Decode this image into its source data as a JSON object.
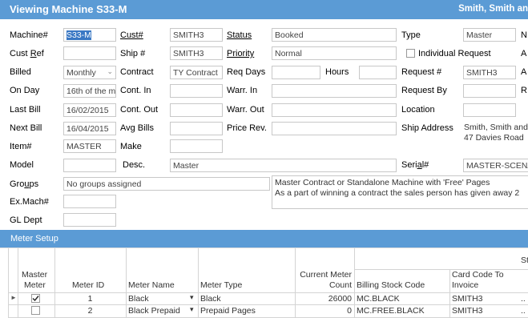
{
  "window": {
    "title": "Viewing Machine S33-M",
    "customer_header": "Smith, Smith an"
  },
  "form": {
    "machine_label": "Machine#",
    "machine_value": "S33-M",
    "cust_label": "Cust#",
    "cust_value": "SMITH3",
    "status_label": "Status",
    "status_value": "Booked",
    "type_label": "Type",
    "type_value": "Master",
    "type_right_cut": "N",
    "custref_label": "Cust Ref",
    "custref_value": "",
    "ship_label": "Ship #",
    "ship_value": "SMITH3",
    "priority_label": "Priority",
    "priority_value": "Normal",
    "individual_request_label": "Individual Request",
    "row2_right_cut": "A",
    "billed_label": "Billed",
    "billed_value": "Monthly",
    "contract_label": "Contract",
    "contract_value": "TY Contract",
    "reqdays_label": "Req Days",
    "reqdays_value": "",
    "hours_label": "Hours",
    "hours_value": "",
    "request_label": "Request #",
    "request_value": "SMITH3",
    "row3_right_cut": "A",
    "onday_label": "On Day",
    "onday_value": "16th of the m",
    "contin_label": "Cont. In",
    "contin_value": "",
    "warrin_label": "Warr. In",
    "warrin_value": "",
    "requestby_label": "Request By",
    "requestby_value": "",
    "row4_right_cut": "R",
    "lastbill_label": "Last Bill",
    "lastbill_value": "16/02/2015",
    "contout_label": "Cont. Out",
    "contout_value": "",
    "warrout_label": "Warr. Out",
    "warrout_value": "",
    "location_label": "Location",
    "location_value": "",
    "nextbill_label": "Next Bill",
    "nextbill_value": "16/04/2015",
    "avgbills_label": "Avg Bills",
    "avgbills_value": "",
    "pricerev_label": "Price Rev.",
    "pricerev_value": "",
    "shipaddr_label": "Ship Address",
    "shipaddr_line1": "Smith, Smith and",
    "shipaddr_line2": "47 Davies Road",
    "item_label": "Item#",
    "item_value": "MASTER",
    "make_label": "Make",
    "make_value": "",
    "model_label": "Model",
    "model_value": "",
    "desc_label": "Desc.",
    "desc_value": "Master",
    "serial_label": "Serial#",
    "serial_value": "MASTER-SCENA",
    "groups_label": "Groups",
    "groups_value": "No groups assigned",
    "notes_line1": "Master Contract or Standalone Machine with 'Free' Pages",
    "notes_line2": "As a part of winning a contract the sales person has given away 2",
    "exmach_label": "Ex.Mach#",
    "exmach_value": "",
    "gldept_label": "GL Dept",
    "gldept_value": ""
  },
  "meter_setup": {
    "title": "Meter Setup",
    "top_right_cut": "St",
    "headers": {
      "master_meter": [
        "Master",
        "Meter"
      ],
      "meter_id": "Meter ID",
      "meter_name": "Meter Name",
      "meter_type": "Meter Type",
      "current_meter_count": [
        "Current Meter",
        "Count"
      ],
      "billing_stock_code": "Billing Stock Code",
      "card_code_to_invoice": [
        "Card Code To",
        "Invoice"
      ]
    },
    "rows": [
      {
        "master": true,
        "id": "1",
        "name": "Black",
        "type": "Black",
        "count": "26000",
        "stock": "MC.BLACK",
        "card": "SMITH3",
        "more": ".."
      },
      {
        "master": false,
        "id": "2",
        "name": "Black Prepaid",
        "type": "Prepaid Pages",
        "count": "0",
        "stock": "MC.FREE.BLACK",
        "card": "SMITH3",
        "more": ".."
      }
    ]
  }
}
